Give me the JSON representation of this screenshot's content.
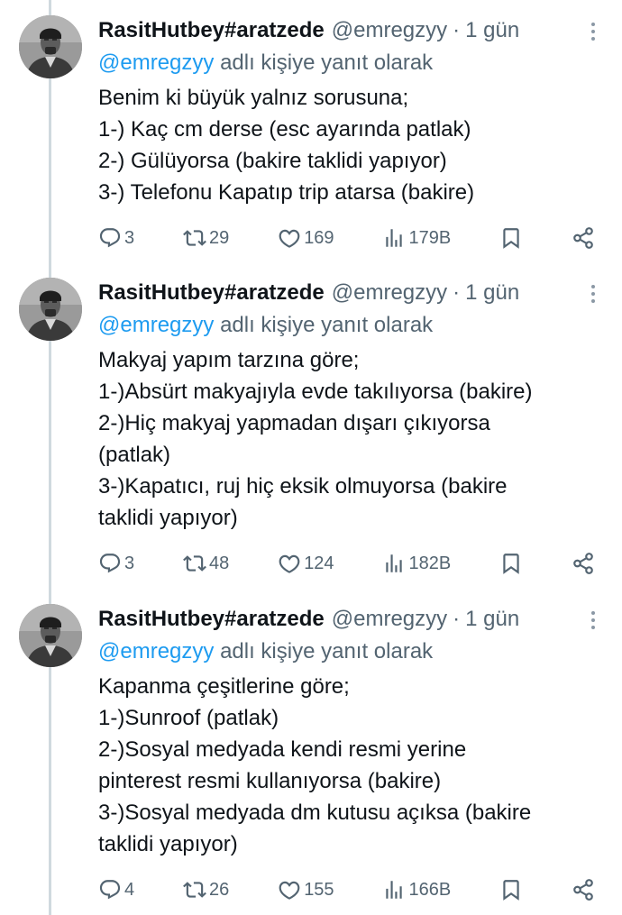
{
  "tweets": [
    {
      "author_name": "RasitHutbey#aratzede",
      "handle": "@emregzyy",
      "separator": "·",
      "time": "1 gün",
      "reply_mention": "@emregzyy",
      "reply_suffix": "adlı kişiye yanıt olarak",
      "lines": [
        "Benim ki büyük yalnız sorusuna;",
        "1-) Kaç cm derse (esc ayarında patlak)",
        "2-) Gülüyorsa (bakire taklidi yapıyor)",
        "3-) Telefonu Kapatıp trip atarsa (bakire)"
      ],
      "replies": "3",
      "retweets": "29",
      "likes": "169",
      "views": "179B"
    },
    {
      "author_name": "RasitHutbey#aratzede",
      "handle": "@emregzyy",
      "separator": "·",
      "time": "1 gün",
      "reply_mention": "@emregzyy",
      "reply_suffix": "adlı kişiye yanıt olarak",
      "lines": [
        "Makyaj yapım tarzına göre;",
        "1-)Absürt makyajıyla evde takılıyorsa (bakire)",
        "2-)Hiç makyaj yapmadan dışarı çıkıyorsa",
        "(patlak)",
        "3-)Kapatıcı, ruj hiç eksik olmuyorsa (bakire",
        "taklidi yapıyor)"
      ],
      "replies": "3",
      "retweets": "48",
      "likes": "124",
      "views": "182B"
    },
    {
      "author_name": "RasitHutbey#aratzede",
      "handle": "@emregzyy",
      "separator": "·",
      "time": "1 gün",
      "reply_mention": "@emregzyy",
      "reply_suffix": "adlı kişiye yanıt olarak",
      "lines": [
        "Kapanma çeşitlerine göre;",
        "1-)Sunroof (patlak)",
        "2-)Sosyal medyada kendi resmi yerine",
        "pinterest resmi kullanıyorsa (bakire)",
        "3-)Sosyal medyada dm kutusu açıksa (bakire",
        "taklidi yapıyor)"
      ],
      "replies": "4",
      "retweets": "26",
      "likes": "155",
      "views": "166B"
    }
  ],
  "colors": {
    "text": "#0f1419",
    "secondary": "#536471",
    "link": "#1d9bf0",
    "thread_line": "#cfd9de"
  },
  "icons": {
    "avatar": "profile-photo",
    "more": "more-vertical-icon",
    "reply": "reply-icon",
    "retweet": "retweet-icon",
    "like": "heart-icon",
    "views": "views-icon",
    "bookmark": "bookmark-icon",
    "share": "share-icon"
  }
}
